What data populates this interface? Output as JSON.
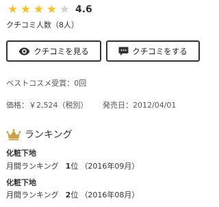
{
  "rating": {
    "stars_filled": 4,
    "stars_total": 5,
    "score": "4.6",
    "star_color": "#f5c02b",
    "star_empty_color": "#d3d3d3"
  },
  "review_count_text": "クチコミ人数（8人）",
  "buttons": {
    "view_reviews": "クチコミを見る",
    "view_reviews_icon": "eye-icon",
    "write_review": "クチコミをする",
    "write_review_icon": "speech-bubble-icon"
  },
  "best_cosme_text": "ベストコスメ受賞：0回",
  "price_text": "価格：￥2,524（税別）",
  "release_label": "発売日：",
  "release_date": "2012/04/01",
  "ranking": {
    "title": "ランキング",
    "icon": "crown-icon",
    "entries": [
      {
        "category": "化粧下地",
        "type": "月間ランキング",
        "position": "1",
        "position_suffix": "位",
        "period": "（2016年09月）"
      },
      {
        "category": "化粧下地",
        "type": "月間ランキング",
        "position": "2",
        "position_suffix": "位",
        "period": "（2016年08月）"
      }
    ]
  }
}
